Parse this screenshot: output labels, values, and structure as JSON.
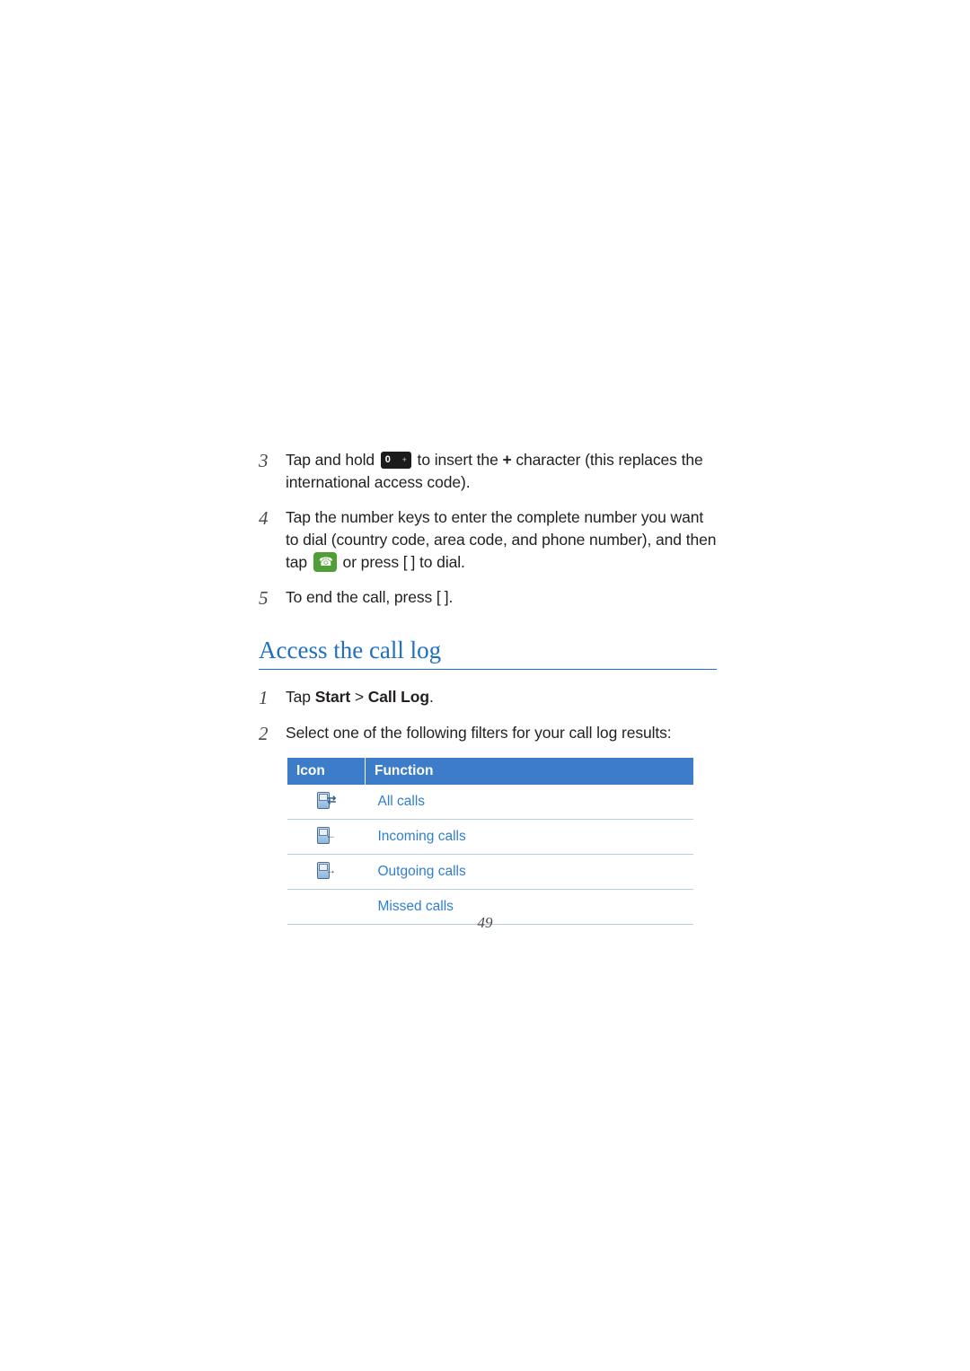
{
  "document": {
    "page_number": "49"
  },
  "steps_before": [
    {
      "number": "3",
      "text_parts": {
        "before_icon": "Tap and hold ",
        "after_icon_1": " to insert the ",
        "plus": "+",
        "after_icon_2": " character (this replaces the international access code)."
      }
    },
    {
      "number": "4",
      "text_parts": {
        "part1": "Tap the number keys to enter the complete number you want to dial (country code, area code, and phone number), and then tap ",
        "part2": " or press [",
        "part3": "] to dial."
      }
    },
    {
      "number": "5",
      "text_parts": {
        "part1": "To end the call, press [",
        "part2": "]."
      }
    }
  ],
  "section": {
    "heading": "Access the call log",
    "steps": [
      {
        "number": "1",
        "prefix": "Tap ",
        "bold1": "Start",
        "sep": " > ",
        "bold2": "Call Log",
        "suffix": "."
      },
      {
        "number": "2",
        "text": "Select one of the following filters for your call log results:"
      }
    ]
  },
  "table": {
    "headers": {
      "icon": "Icon",
      "function": "Function"
    },
    "rows": [
      {
        "icon_name": "all-calls-icon",
        "function": "All calls"
      },
      {
        "icon_name": "incoming-calls-icon",
        "function": "Incoming calls"
      },
      {
        "icon_name": "outgoing-calls-icon",
        "function": "Outgoing calls"
      },
      {
        "icon_name": "missed-calls-icon",
        "function": "Missed calls"
      }
    ]
  },
  "colors": {
    "accent_blue": "#1f6fc4",
    "link_blue": "#2f7fd0",
    "table_header_bg": "#3d7cc9",
    "send_key_green": "#4f9e36"
  }
}
